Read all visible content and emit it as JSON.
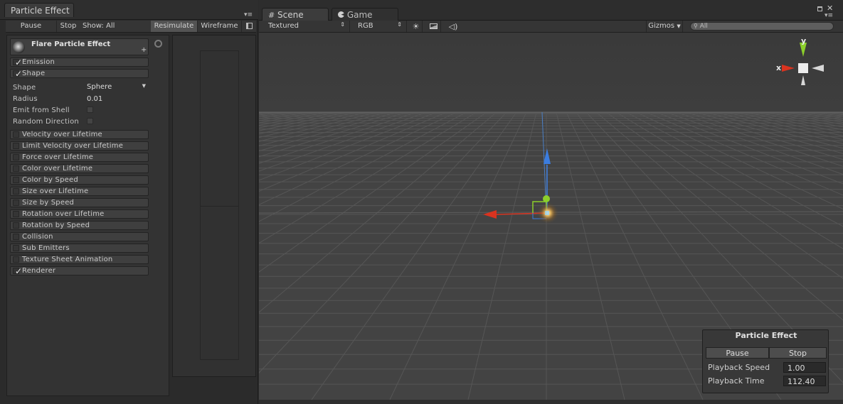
{
  "left_panel": {
    "tab_title": "Particle Effect",
    "toolbar": {
      "pause": "Pause",
      "stop": "Stop",
      "show_all": "Show: All",
      "resimulate": "Resimulate",
      "wireframe": "Wireframe"
    },
    "effect_title": "Flare Particle Effect",
    "add_symbol": "+",
    "modules": [
      {
        "label": "Emission",
        "checked": true
      },
      {
        "label": "Shape",
        "checked": true
      },
      {
        "label": "Velocity over Lifetime",
        "checked": false
      },
      {
        "label": "Limit Velocity over Lifetime",
        "checked": false
      },
      {
        "label": "Force over Lifetime",
        "checked": false
      },
      {
        "label": "Color over Lifetime",
        "checked": false
      },
      {
        "label": "Color by Speed",
        "checked": false
      },
      {
        "label": "Size over Lifetime",
        "checked": false
      },
      {
        "label": "Size by Speed",
        "checked": false
      },
      {
        "label": "Rotation over Lifetime",
        "checked": false
      },
      {
        "label": "Rotation by Speed",
        "checked": false
      },
      {
        "label": "Collision",
        "checked": false
      },
      {
        "label": "Sub Emitters",
        "checked": false
      },
      {
        "label": "Texture Sheet Animation",
        "checked": false
      },
      {
        "label": "Renderer",
        "checked": true
      }
    ],
    "shape_props": {
      "shape_label": "Shape",
      "shape_value": "Sphere",
      "radius_label": "Radius",
      "radius_value": "0.01",
      "emit_from_shell_label": "Emit from Shell",
      "random_direction_label": "Random Direction"
    }
  },
  "scene": {
    "tabs": {
      "scene": "Scene",
      "game": "Game"
    },
    "toolbar": {
      "render_mode": "Textured",
      "color_mode": "RGB",
      "gizmos": "Gizmos",
      "search_placeholder": "All"
    },
    "gizmo_labels": {
      "x": "x",
      "y": "y"
    },
    "overlay": {
      "title": "Particle Effect",
      "pause": "Pause",
      "stop": "Stop",
      "playback_speed_label": "Playback Speed",
      "playback_speed_value": "1.00",
      "playback_time_label": "Playback Time",
      "playback_time_value": "112.40"
    }
  },
  "colors": {
    "axis_x": "#d9331f",
    "axis_y": "#8ccf2b",
    "axis_z": "#3b7de0",
    "background": "#2b2b2b",
    "scene_fill": "#434343"
  },
  "window_icons": {
    "maximize": "maximize-icon",
    "close": "close-icon",
    "menu": "panel-menu-icon"
  }
}
